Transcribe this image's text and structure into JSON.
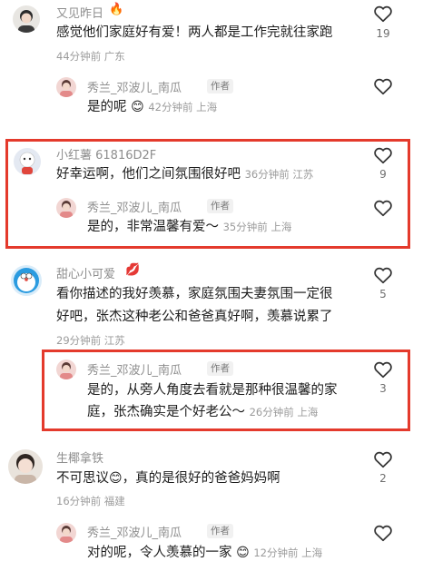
{
  "comments": [
    {
      "username": "又见昨日",
      "text": "感觉他们家庭好有爱！两人都是工作完就往家跑",
      "meta": "44分钟前 广东",
      "likes": "19",
      "reply": {
        "username": "秀兰_邓波儿_南瓜",
        "author_tag": "作者",
        "text": "是的呢",
        "meta": "42分钟前 上海"
      }
    },
    {
      "username": "小红薯 61816D2F",
      "text": "好幸运啊，他们之间氛围很好吧",
      "meta": "36分钟前 江苏",
      "likes": "9",
      "reply": {
        "username": "秀兰_邓波儿_南瓜",
        "author_tag": "作者",
        "text": "是的，非常温馨有爱～",
        "meta": "35分钟前 上海"
      }
    },
    {
      "username": "甜心小可爱",
      "text_line1": "看你描述的我好羡慕，家庭氛围夫妻氛围一定很",
      "text_line2": "好吧，张杰这种老公和爸爸真好啊，羡慕说累了",
      "meta": "29分钟前 江苏",
      "likes": "5",
      "reply": {
        "username": "秀兰_邓波儿_南瓜",
        "author_tag": "作者",
        "text_line1": "是的，从旁人角度去看就是那种很温馨的家",
        "text_line2": "庭，张杰确实是个好老公～",
        "meta": "26分钟前 上海",
        "likes": "3"
      }
    },
    {
      "username": "生椰拿铁",
      "text_part1": "不可思议",
      "text_part2": "，真的是很好的爸爸妈妈啊",
      "meta": "16分钟前 福建",
      "likes": "2",
      "reply": {
        "username": "秀兰_邓波儿_南瓜",
        "author_tag": "作者",
        "text": "对的呢，令人羡慕的一家",
        "meta": "12分钟前 上海"
      }
    }
  ],
  "colors": {
    "highlight": "#e43a2c",
    "text": "#1d1d1d",
    "meta": "#9b9b9b",
    "name": "#8e8e8e"
  }
}
